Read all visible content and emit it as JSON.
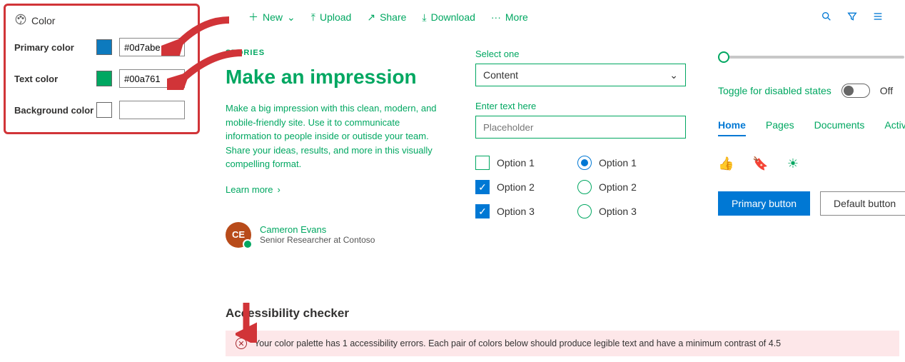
{
  "colorPanel": {
    "title": "Color",
    "rows": {
      "primary": {
        "label": "Primary color",
        "value": "#0d7abe"
      },
      "text": {
        "label": "Text color",
        "value": "#00a761"
      },
      "bg": {
        "label": "Background color",
        "value": ""
      }
    }
  },
  "toolbar": {
    "new": "New",
    "upload": "Upload",
    "share": "Share",
    "download": "Download",
    "more": "More"
  },
  "story": {
    "eyebrow": "STORIES",
    "headline": "Make an impression",
    "body": "Make a big impression with this clean, modern, and mobile-friendly site. Use it to communicate information to people inside or outisde your team. Share your ideas, results, and more in this visually compelling format.",
    "learnMore": "Learn more",
    "author": {
      "initials": "CE",
      "name": "Cameron Evans",
      "title": "Senior Researcher at Contoso"
    }
  },
  "form": {
    "selectLabel": "Select one",
    "selectValue": "Content",
    "textLabel": "Enter text here",
    "textPlaceholder": "Placeholder",
    "checkboxes": [
      {
        "label": "Option 1",
        "checked": false
      },
      {
        "label": "Option 2",
        "checked": true
      },
      {
        "label": "Option 3",
        "checked": true
      }
    ],
    "radios": [
      {
        "label": "Option 1",
        "selected": true
      },
      {
        "label": "Option 2",
        "selected": false
      },
      {
        "label": "Option 3",
        "selected": false
      }
    ]
  },
  "right": {
    "sliderValue": "0",
    "toggleLabel": "Toggle for disabled states",
    "toggleState": "Off",
    "tabs": [
      "Home",
      "Pages",
      "Documents",
      "Activity"
    ],
    "primaryBtn": "Primary button",
    "defaultBtn": "Default button"
  },
  "a11y": {
    "title": "Accessibility checker",
    "message": "Your color palette has 1 accessibility errors. Each pair of colors below should produce legible text and have a minimum contrast of 4.5"
  }
}
